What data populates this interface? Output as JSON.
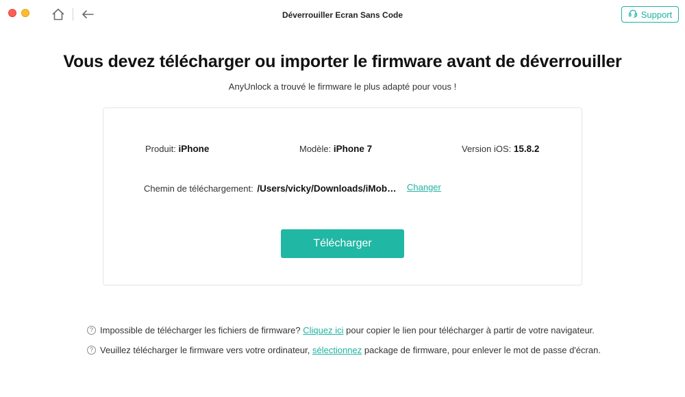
{
  "window": {
    "title": "Déverrouiller Ecran Sans Code"
  },
  "toolbar": {
    "home_icon": "home-icon",
    "back_icon": "back-arrow-icon",
    "support_label": "Support",
    "support_icon": "headset-icon"
  },
  "header": {
    "title": "Vous devez télécharger ou importer le firmware avant de déverrouiller",
    "subtitle": "AnyUnlock a trouvé le firmware le plus adapté pour vous !"
  },
  "firmware": {
    "product_label": "Produit:",
    "product_value": "iPhone",
    "model_label": "Modèle:",
    "model_value": "iPhone 7",
    "ios_label": "Version iOS:",
    "ios_value": "15.8.2",
    "path_label": "Chemin de téléchargement:",
    "path_value": "/Users/vicky/Downloads/iMobie/AnyUnlock",
    "change_label": "Changer",
    "download_label": "Télécharger"
  },
  "help": {
    "line1_before": "Impossible de télécharger les fichiers de firmware?",
    "line1_link": "Cliquez ici",
    "line1_after": "pour copier le lien pour télécharger à partir de votre navigateur.",
    "line2_before": "Veuillez télécharger le firmware vers votre ordinateur,",
    "line2_link": "sélectionnez",
    "line2_after": "package de firmware, pour enlever le mot de passe d'écran.",
    "icon": "question-circle-icon"
  },
  "colors": {
    "accent": "#20b7a4",
    "close": "#fe5f57",
    "minimize": "#febc2e"
  }
}
